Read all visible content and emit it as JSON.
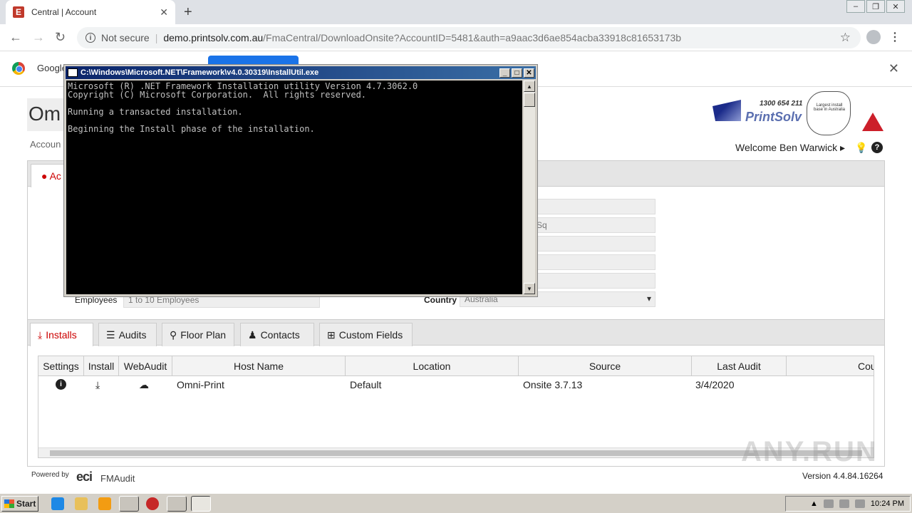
{
  "browser": {
    "tab_title": "Central | Account",
    "tab_favicon_letter": "E",
    "security_label": "Not secure",
    "url_host": "demo.printsolv.com.au",
    "url_path": "/FmaCentral/DownloadOnsite?AccountID=5481&auth=a9aac3d6ae854acba33918c81653173b",
    "infobar_text": "Google"
  },
  "page": {
    "title": "Om",
    "breadcrumb": "Accoun",
    "welcome": "Welcome Ben Warwick",
    "account_tab_label": "Ac",
    "logo": {
      "phone": "1300 654 211",
      "brand": "PrintSolv",
      "map_text": "Largest install base in Australia"
    },
    "fields": {
      "employees_label": "Employees",
      "employees_value": "1 to 10 Employees",
      "country_label": "Country",
      "country_value": "Australia",
      "location_value": "Sq"
    },
    "tabs": [
      {
        "label": "Installs",
        "icon": "download-icon",
        "active": true
      },
      {
        "label": "Audits",
        "icon": "list-icon",
        "active": false
      },
      {
        "label": "Floor Plan",
        "icon": "map-marker-icon",
        "active": false
      },
      {
        "label": "Contacts",
        "icon": "contacts-icon",
        "active": false
      },
      {
        "label": "Custom Fields",
        "icon": "plus-square-icon",
        "active": false
      }
    ],
    "grid": {
      "headers": [
        "Settings",
        "Install",
        "WebAudit",
        "Host Name",
        "Location",
        "Source",
        "Last Audit",
        "Cou"
      ],
      "rows": [
        {
          "host_name": "Omni-Print",
          "location": "Default",
          "source": "Onsite 3.7.13",
          "last_audit": "3/4/2020"
        }
      ]
    },
    "footer": {
      "powered_by": "Powered by",
      "eci": "eci",
      "fmaudit": "FMAudit",
      "version": "Version 4.4.84.16264"
    },
    "watermark": "ANY.RUN"
  },
  "console": {
    "title": "C:\\Windows\\Microsoft.NET\\Framework\\v4.0.30319\\InstallUtil.exe",
    "lines": [
      "Microsoft (R) .NET Framework Installation utility Version 4.7.3062.0",
      "Copyright (C) Microsoft Corporation.  All rights reserved.",
      "",
      "Running a transacted installation.",
      "",
      "Beginning the Install phase of the installation."
    ]
  },
  "taskbar": {
    "start_label": "Start",
    "clock": "10:24 PM"
  }
}
